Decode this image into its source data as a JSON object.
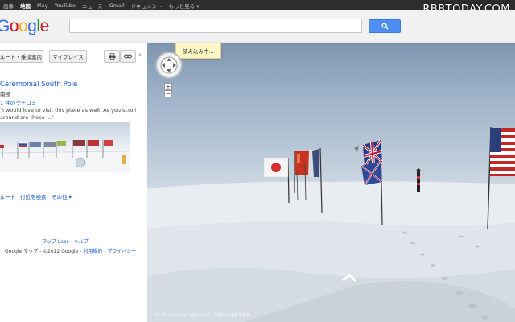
{
  "topbar": {
    "links": [
      "画像",
      "地図",
      "Play",
      "YouTube",
      "ニュース",
      "Gmail",
      "ドキュメント",
      "もっと見る ▾"
    ],
    "active_index": 1
  },
  "watermark": "RBBTODAY.COM",
  "header": {
    "logo": {
      "g1": "G",
      "o1": "o",
      "o2": "o",
      "g2": "g",
      "l": "l",
      "e": "e"
    },
    "search_value": "",
    "search_button_icon": "magnifier-icon"
  },
  "left_panel": {
    "route_button": "ルート・乗換案内",
    "myplaces_button": "マイプレイス",
    "print_icon": "printer-icon",
    "link_icon": "chain-link-icon",
    "collapse_icon": "«",
    "place_title": "Ceremonial South Pole",
    "place_subtitle": "南極",
    "review_link": "1 件のクチコミ",
    "review_text": "\"I would love to visit this place as well. As you scroll around are those ...\" -",
    "actions": [
      "ルート",
      "付近を検索",
      "その他 ▾"
    ],
    "footer_line1": "マップ Labs - ヘルプ",
    "footer_map": "Google マップ - ",
    "footer_copyright": "©2012 Google",
    "footer_terms": " - 利用規約",
    "footer_privacy": " - プライバシー"
  },
  "streetview": {
    "loading_text": "読み込み中...",
    "zoom_in": "+",
    "zoom_out": "−",
    "attribution": "© 2012 Google  ·  画像の日付  ·  不適切な画像を報告"
  },
  "colors": {
    "accent_blue": "#4d8ef0",
    "link": "#1155cc",
    "topbar": "#2d2d2d",
    "tooltip_bg": "#fff8c6"
  }
}
